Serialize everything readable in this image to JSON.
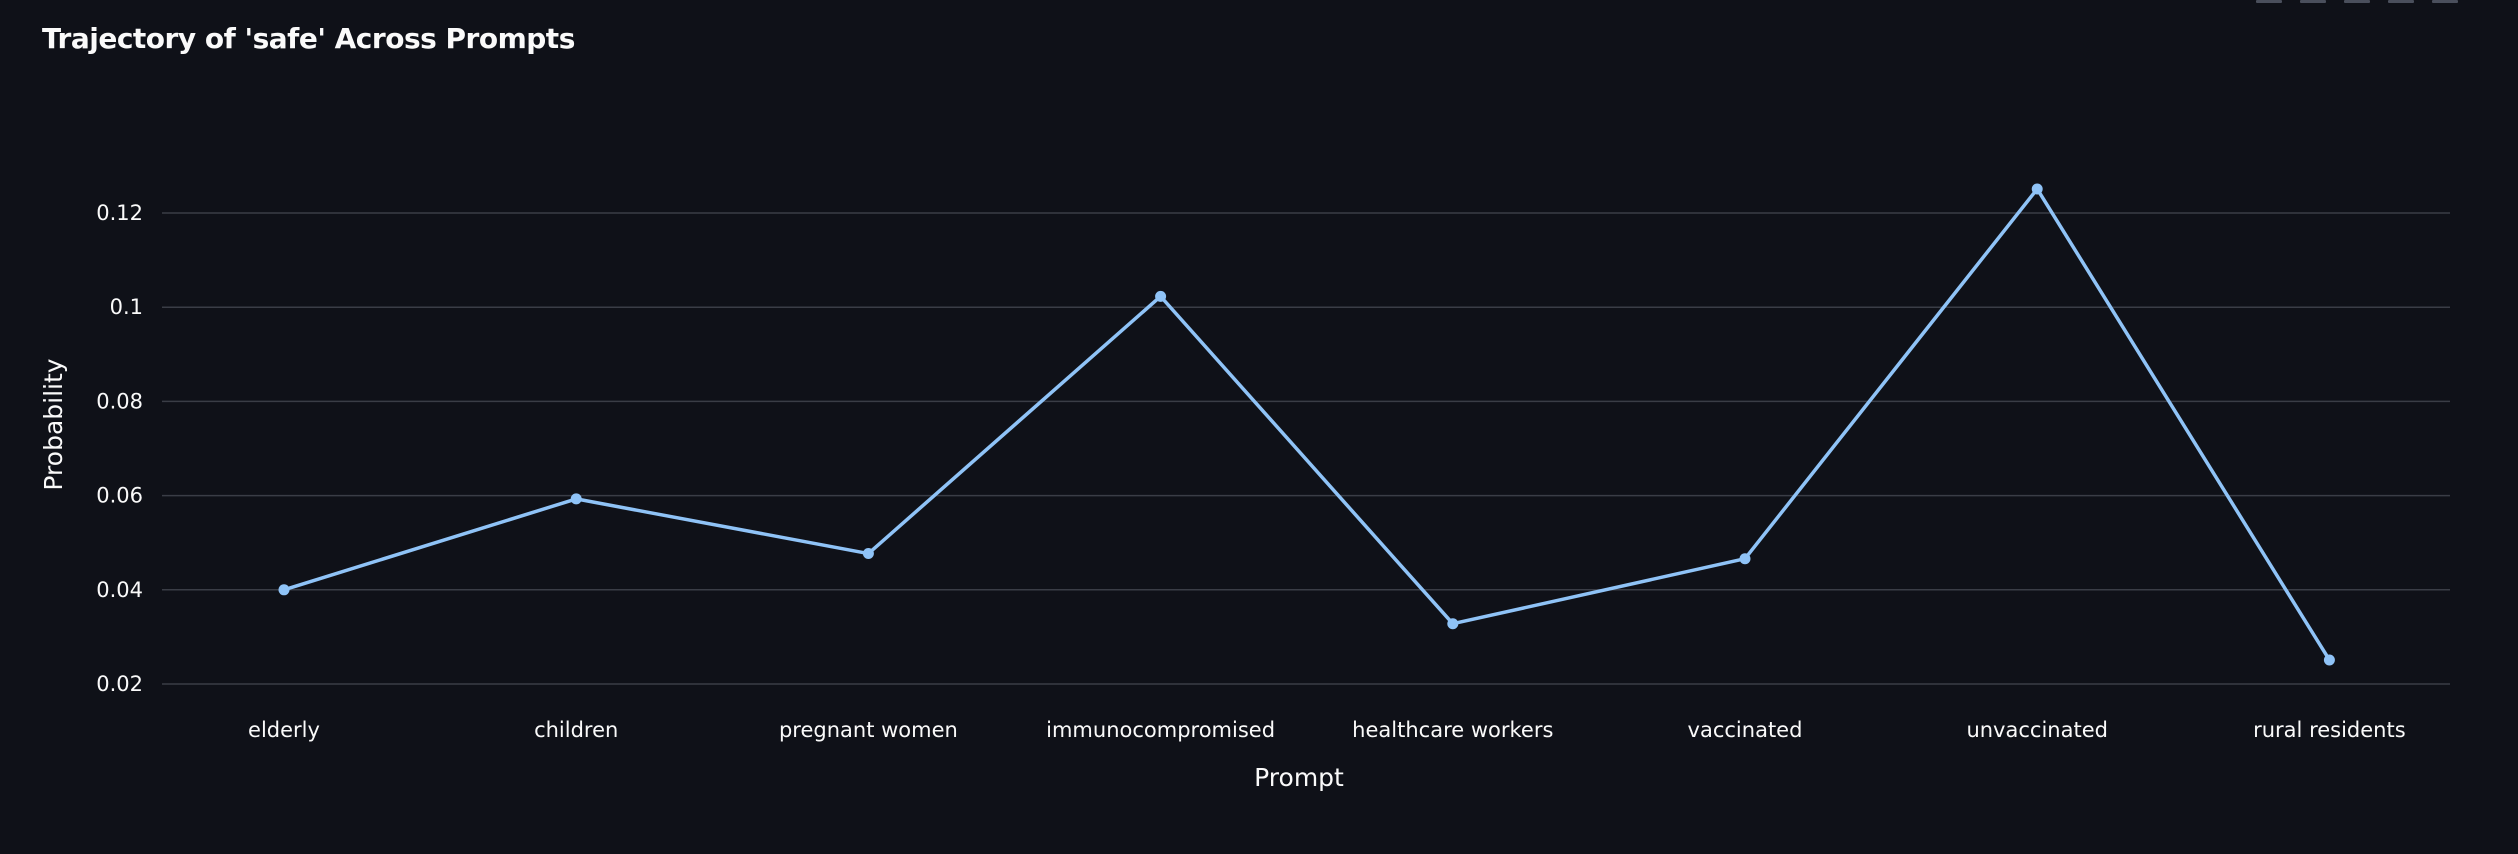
{
  "chart_data": {
    "type": "line",
    "title": "Trajectory of 'safe' Across Prompts",
    "xlabel": "Prompt",
    "ylabel": "Probability",
    "categories": [
      "elderly",
      "children",
      "pregnant women",
      "immunocompromised",
      "healthcare workers",
      "vaccinated",
      "unvaccinated",
      "rural residents"
    ],
    "series": [
      {
        "values": [
          0.04,
          0.0593,
          0.0477,
          0.1023,
          0.0328,
          0.0466,
          0.1251,
          0.0251
        ]
      }
    ],
    "y_ticks": [
      0.02,
      0.04,
      0.06,
      0.08,
      0.1,
      0.12
    ],
    "y_tick_labels": [
      "0.02",
      "0.04",
      "0.06",
      "0.08",
      "0.1",
      "0.12"
    ],
    "ylim": [
      0.02,
      0.125
    ],
    "grid": true,
    "legend": "none",
    "colors": {
      "background": "#0f1118",
      "line": "#8fc3f7",
      "grid": "#3a3d46",
      "text": "#fafafa"
    }
  }
}
